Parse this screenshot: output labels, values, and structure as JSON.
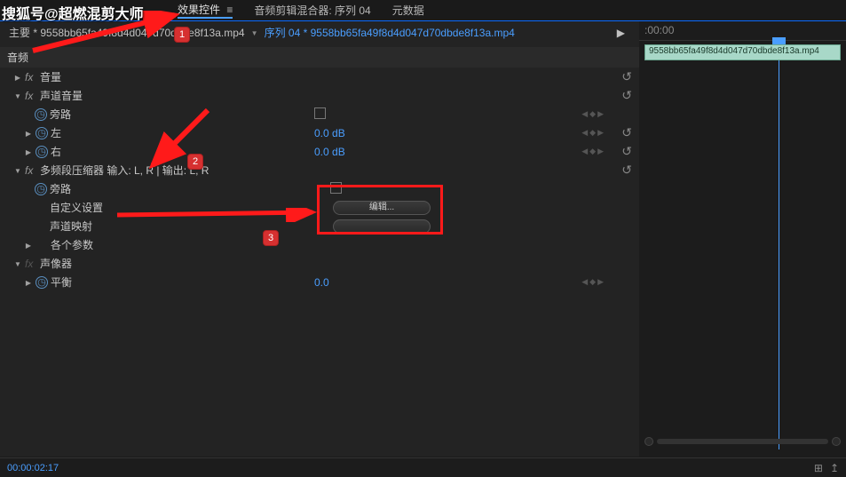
{
  "watermark": "搜狐号@超燃混剪大师",
  "tabs": {
    "effect_controls": "效果控件",
    "audio_mixer": "音频剪辑混合器: 序列 04",
    "metadata": "元数据"
  },
  "breadcrumb": {
    "main_prefix": "主要 * ",
    "clip_name": "9558bb65fa49f8d4d047d70dbde8f13a.mp4",
    "sequence": "序列 04 * 9558bb65fa49f8d4d047d70dbde8f13a.mp4"
  },
  "section_audio": "音频",
  "fx": {
    "volume": "音量",
    "channel_volume": "声道音量",
    "bypass": "旁路",
    "left": "左",
    "right": "右",
    "multiband": "多频段压缩器 输入: L, R | 输出: L, R",
    "custom_setup": "自定义设置",
    "channel_map": "声道映射",
    "params": "各个参数",
    "panner": "声像器",
    "balance": "平衡"
  },
  "values": {
    "left_db": "0.0 dB",
    "right_db": "0.0 dB",
    "balance": "0.0",
    "edit": "编辑..."
  },
  "badges": {
    "b1": "1",
    "b2": "2",
    "b3": "3"
  },
  "timeline": {
    "start": ":00:00",
    "clip_name": "9558bb65fa49f8d4d047d70dbde8f13a.mp4"
  },
  "footer": {
    "timecode": "00:00:02:17"
  }
}
